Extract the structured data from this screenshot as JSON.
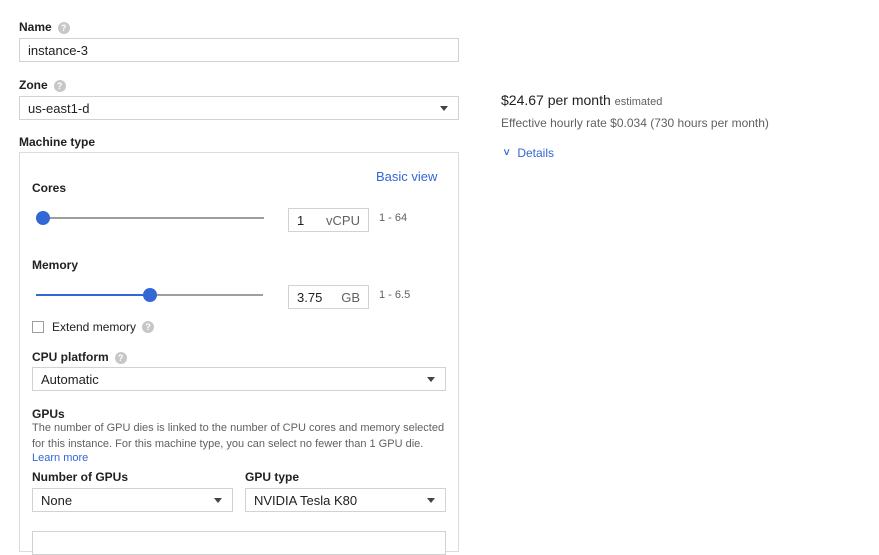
{
  "name": {
    "label": "Name",
    "value": "instance-3"
  },
  "zone": {
    "label": "Zone",
    "value": "us-east1-d"
  },
  "machine_type": {
    "label": "Machine type",
    "basic_view_link": "Basic view",
    "cores": {
      "label": "Cores",
      "value": "1",
      "unit": "vCPU",
      "range": "1 - 64",
      "slider_fraction": 0.0
    },
    "memory": {
      "label": "Memory",
      "value": "3.75",
      "unit": "GB",
      "range": "1 - 6.5",
      "slider_fraction": 0.5
    },
    "extend_memory": {
      "label": "Extend memory",
      "checked": false
    },
    "cpu_platform": {
      "label": "CPU platform",
      "value": "Automatic"
    },
    "gpus": {
      "heading": "GPUs",
      "description": "The number of GPU dies is linked to the number of CPU cores and memory selected for this instance. For this machine type, you can select no fewer than 1 GPU die.",
      "learn_more": "Learn more",
      "number_label": "Number of GPUs",
      "number_value": "None",
      "type_label": "GPU type",
      "type_value": "NVIDIA Tesla K80"
    }
  },
  "pricing": {
    "monthly": "$24.67 per month",
    "estimated": "estimated",
    "hourly": "Effective hourly rate $0.034 (730 hours per month)",
    "details_link": "Details"
  },
  "icons": {
    "help": "help-icon",
    "dropdown": "dropdown-caret-icon",
    "expand": "double-chevron-down-icon"
  },
  "colors": {
    "accent": "#3367d6",
    "border": "#d2d2d2",
    "text": "#212121",
    "muted": "#616161"
  }
}
